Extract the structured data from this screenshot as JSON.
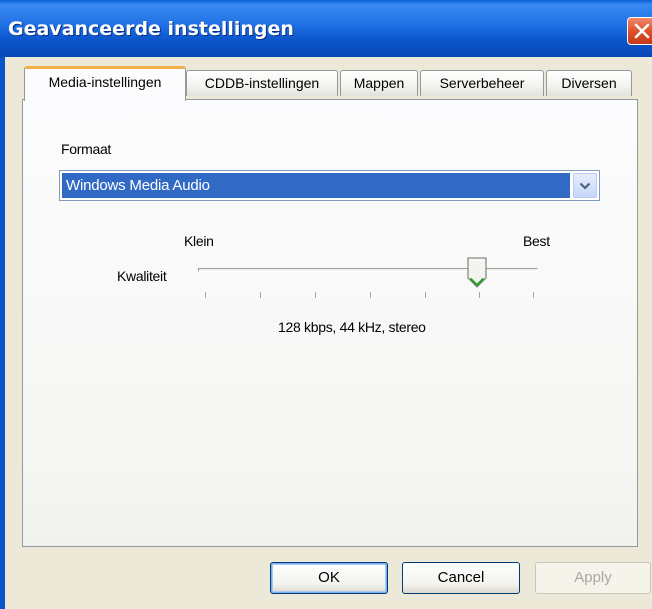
{
  "window": {
    "title": "Geavanceerde instellingen"
  },
  "tabs": [
    {
      "label": "Media-instellingen"
    },
    {
      "label": "CDDB-instellingen"
    },
    {
      "label": "Mappen"
    },
    {
      "label": "Serverbeheer"
    },
    {
      "label": "Diversen"
    }
  ],
  "media": {
    "format_label": "Formaat",
    "format_value": "Windows Media Audio",
    "quality_label": "Kwaliteit",
    "quality_min_label": "Klein",
    "quality_max_label": "Best",
    "quality_level": 0.83,
    "quality_description": "128 kbps, 44 kHz, stereo"
  },
  "buttons": {
    "ok": "OK",
    "cancel": "Cancel",
    "apply": "Apply"
  },
  "icons": {
    "close": "close-icon",
    "dropdown": "chevron-down-icon",
    "slider": "slider-thumb-icon"
  },
  "colors": {
    "titlebar": "#0b55cc",
    "selection": "#316ac5",
    "active_tab_accent": "#f2b04a",
    "close_button": "#e0502c",
    "slider_thumb_accent": "#21a121"
  }
}
